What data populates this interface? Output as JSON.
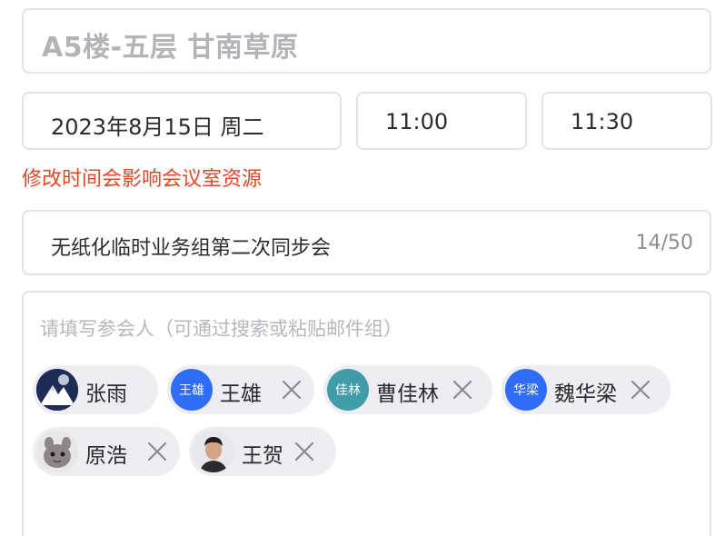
{
  "meeting_room": "A5楼-五层 甘南草原",
  "date": "2023年8月15日 周二",
  "start_time": "11:00",
  "end_time": "11:30",
  "warning": "修改时间会影响会议室资源",
  "subject": "无纸化临时业务组第二次同步会",
  "subject_counter": "14/50",
  "attendee_placeholder": "请填写参会人（可通过搜索或粘贴邮件组）",
  "attendees": [
    {
      "name": "张雨",
      "avatar_text": "",
      "avatar_color": "#1e2b55",
      "removable": false
    },
    {
      "name": "王雄",
      "avatar_text": "王雄",
      "avatar_color": "#2f6df6",
      "removable": true
    },
    {
      "name": "曹佳林",
      "avatar_text": "佳林",
      "avatar_color": "#3f9ca8",
      "removable": true
    },
    {
      "name": "魏华梁",
      "avatar_text": "华梁",
      "avatar_color": "#2f6df6",
      "removable": true
    },
    {
      "name": "原浩",
      "avatar_text": "",
      "avatar_color": "#9a8f95",
      "removable": true
    },
    {
      "name": "王贺",
      "avatar_text": "",
      "avatar_color": "#d8d8dc",
      "removable": true
    }
  ],
  "colors": {
    "warning": "#e0482a",
    "chip_bg": "#eeeef2",
    "border": "#e3e3e6"
  }
}
